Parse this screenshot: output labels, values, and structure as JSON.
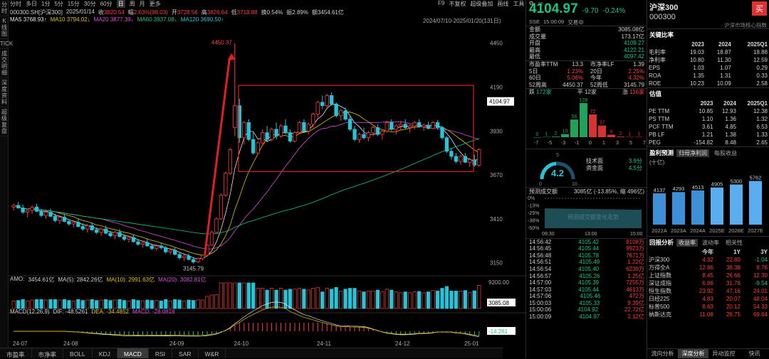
{
  "left_tabs": [
    "分时",
    "K线图",
    "TICK",
    "成交明细",
    "深度资料",
    "超级复盘"
  ],
  "top_toolbar": {
    "items": [
      "分时",
      "多日",
      "1分",
      "5分",
      "15分",
      "30分",
      "60分",
      "日",
      "周",
      "月",
      "更多"
    ],
    "active": "日",
    "right_items": [
      "F9",
      "不复权",
      "超级叠加",
      "画线",
      "工具",
      "⚙",
      "▭"
    ]
  },
  "info": {
    "code": "000300.SH[沪深300]",
    "date": "2025/01/14",
    "close_label": "收",
    "close": "3820.54",
    "change_label": "幅",
    "change": "2.63%(98.03)",
    "open_label": "开",
    "open": "3728.56",
    "high_label": "高",
    "high": "3826.64",
    "low_label": "低",
    "low": "3718.88",
    "turnover": "换0.54%",
    "amplitude": "振2.89%",
    "amount": "额3454.61亿"
  },
  "ma": [
    {
      "label": "MA5",
      "value": "3768.93↑",
      "color": "#e8e8e8"
    },
    {
      "label": "MA10",
      "value": "3794.02↓",
      "color": "#e6c200"
    },
    {
      "label": "MA20",
      "value": "3877.39↓",
      "color": "#d94fd9"
    },
    {
      "label": "MA60",
      "value": "3937.08↓",
      "color": "#16c784"
    },
    {
      "label": "MA120",
      "value": "3690.50↑",
      "color": "#27c4d8"
    }
  ],
  "range_label": "2024/07/10-2025/01/20(131日)",
  "chart_data": {
    "type": "candlestick",
    "x_ticks": [
      "24-07",
      "24-08",
      "24-09",
      "24-10",
      "24-11",
      "24-12",
      "25-01"
    ],
    "y_ticks": [
      4450,
      4190,
      3930,
      3670,
      3410,
      3150
    ],
    "ylim": [
      3090,
      4520
    ],
    "high_label": "4450.37",
    "low_label": "3145.79",
    "last_price_tag": "4104.97",
    "volume_ticks": [
      "9200.00",
      "3085.08"
    ],
    "macd_tag": "-14.261",
    "ohlc": [
      [
        3480,
        3500,
        3460,
        3490
      ],
      [
        3490,
        3510,
        3470,
        3475
      ],
      [
        3475,
        3495,
        3440,
        3450
      ],
      [
        3450,
        3470,
        3420,
        3460
      ],
      [
        3460,
        3490,
        3440,
        3480
      ],
      [
        3480,
        3500,
        3450,
        3455
      ],
      [
        3455,
        3470,
        3420,
        3430
      ],
      [
        3430,
        3460,
        3410,
        3450
      ],
      [
        3450,
        3470,
        3420,
        3425
      ],
      [
        3425,
        3440,
        3390,
        3400
      ],
      [
        3400,
        3430,
        3380,
        3420
      ],
      [
        3420,
        3440,
        3390,
        3395
      ],
      [
        3395,
        3410,
        3370,
        3380
      ],
      [
        3380,
        3400,
        3360,
        3390
      ],
      [
        3390,
        3410,
        3360,
        3365
      ],
      [
        3365,
        3385,
        3340,
        3350
      ],
      [
        3350,
        3380,
        3330,
        3370
      ],
      [
        3370,
        3390,
        3340,
        3345
      ],
      [
        3345,
        3360,
        3320,
        3330
      ],
      [
        3330,
        3360,
        3310,
        3350
      ],
      [
        3350,
        3370,
        3320,
        3325
      ],
      [
        3325,
        3340,
        3300,
        3310
      ],
      [
        3310,
        3340,
        3290,
        3330
      ],
      [
        3330,
        3350,
        3300,
        3305
      ],
      [
        3305,
        3320,
        3280,
        3290
      ],
      [
        3290,
        3310,
        3270,
        3300
      ],
      [
        3300,
        3320,
        3270,
        3275
      ],
      [
        3275,
        3290,
        3250,
        3260
      ],
      [
        3260,
        3280,
        3240,
        3270
      ],
      [
        3270,
        3290,
        3245,
        3250
      ],
      [
        3250,
        3265,
        3225,
        3235
      ],
      [
        3235,
        3260,
        3220,
        3250
      ],
      [
        3250,
        3270,
        3230,
        3240
      ],
      [
        3240,
        3250,
        3205,
        3215
      ],
      [
        3215,
        3235,
        3200,
        3225
      ],
      [
        3225,
        3240,
        3195,
        3200
      ],
      [
        3200,
        3215,
        3170,
        3180
      ],
      [
        3180,
        3200,
        3160,
        3190
      ],
      [
        3190,
        3205,
        3165,
        3170
      ],
      [
        3170,
        3185,
        3146,
        3155
      ],
      [
        3155,
        3180,
        3150,
        3175
      ],
      [
        3175,
        3200,
        3165,
        3195
      ],
      [
        3195,
        3260,
        3190,
        3255
      ],
      [
        3255,
        3340,
        3250,
        3330
      ],
      [
        3330,
        3420,
        3325,
        3410
      ],
      [
        3410,
        3560,
        3405,
        3550
      ],
      [
        3550,
        3690,
        3540,
        3680
      ],
      [
        3680,
        3830,
        3670,
        3820
      ],
      [
        3950,
        4450,
        3900,
        4080
      ],
      [
        4080,
        4120,
        3860,
        3890
      ],
      [
        3890,
        3990,
        3850,
        3980
      ],
      [
        3980,
        4000,
        3870,
        3880
      ],
      [
        3880,
        3920,
        3790,
        3800
      ],
      [
        3800,
        3870,
        3790,
        3860
      ],
      [
        3860,
        3940,
        3850,
        3920
      ],
      [
        3920,
        3960,
        3870,
        3880
      ],
      [
        3880,
        3950,
        3870,
        3940
      ],
      [
        3940,
        3980,
        3880,
        3900
      ],
      [
        3900,
        3970,
        3890,
        3960
      ],
      [
        3960,
        4000,
        3910,
        3920
      ],
      [
        3920,
        3940,
        3860,
        3870
      ],
      [
        3870,
        3930,
        3860,
        3920
      ],
      [
        3920,
        3990,
        3910,
        3980
      ],
      [
        3980,
        4000,
        3920,
        3930
      ],
      [
        3930,
        3980,
        3910,
        3970
      ],
      [
        3970,
        4040,
        3950,
        4030
      ],
      [
        4030,
        4110,
        4010,
        4100
      ],
      [
        4100,
        4140,
        4060,
        4080
      ],
      [
        4080,
        4150,
        4070,
        4140
      ],
      [
        4140,
        4160,
        4080,
        4090
      ],
      [
        4090,
        4100,
        4010,
        4020
      ],
      [
        4020,
        4060,
        3990,
        4050
      ],
      [
        4050,
        4070,
        3990,
        4000
      ],
      [
        4000,
        4020,
        3930,
        3940
      ],
      [
        3940,
        3960,
        3870,
        3880
      ],
      [
        3880,
        3920,
        3860,
        3910
      ],
      [
        3910,
        3950,
        3880,
        3890
      ],
      [
        3890,
        3930,
        3870,
        3920
      ],
      [
        3920,
        3960,
        3900,
        3950
      ],
      [
        3950,
        3970,
        3900,
        3910
      ],
      [
        3910,
        3940,
        3880,
        3930
      ],
      [
        3930,
        3990,
        3920,
        3980
      ],
      [
        3980,
        4000,
        3930,
        3940
      ],
      [
        3940,
        3970,
        3910,
        3960
      ],
      [
        3960,
        3990,
        3930,
        3970
      ],
      [
        3970,
        4000,
        3940,
        3950
      ],
      [
        3950,
        3970,
        3920,
        3960
      ],
      [
        3960,
        3990,
        3940,
        3980
      ],
      [
        3980,
        4000,
        3950,
        3955
      ],
      [
        3955,
        3975,
        3930,
        3965
      ],
      [
        3965,
        3985,
        3940,
        3945
      ],
      [
        3945,
        3990,
        3940,
        3980
      ],
      [
        3980,
        3995,
        3940,
        3950
      ],
      [
        3950,
        3960,
        3880,
        3890
      ],
      [
        3890,
        3900,
        3800,
        3810
      ],
      [
        3810,
        3830,
        3760,
        3780
      ],
      [
        3780,
        3800,
        3740,
        3750
      ],
      [
        3750,
        3790,
        3730,
        3780
      ],
      [
        3780,
        3800,
        3740,
        3745
      ],
      [
        3745,
        3770,
        3720,
        3760
      ],
      [
        3760,
        3790,
        3718,
        3728
      ],
      [
        3728,
        3826,
        3718,
        3820
      ]
    ]
  },
  "amo": {
    "label": "AMO:",
    "value": "3454.61亿",
    "ma5": "MA(5): 2842.26亿",
    "ma10": "MA(10): 2991.63亿",
    "ma20": "MA(20): 3082.81亿"
  },
  "macd": {
    "label": "MACD(12,26,9)",
    "dif": "DIF: -48.5261",
    "dea": "DEA: -34.4852",
    "macd": "MACD: -28.0818"
  },
  "bottom_tabs": [
    "市盈率",
    "市净率",
    "BOLL",
    "KDJ",
    "MACD",
    "RSI",
    "SAR",
    "W&R"
  ],
  "bottom_active": "MACD",
  "quote": {
    "price": "4104.97",
    "change": "-9.70",
    "pct": "-0.24%",
    "exchange": "SSE",
    "time": "15:00:09",
    "status": "交易中"
  },
  "stats": [
    [
      "金额",
      "3085.08亿"
    ],
    [
      "成交量",
      "173.17亿"
    ],
    [
      "开盘",
      "4109.27"
    ],
    [
      "最高",
      "4122.21"
    ],
    [
      "最低",
      "4097.42"
    ]
  ],
  "ratios": [
    [
      "市盈率TTM",
      "13.3",
      "市净率LF",
      "1.39"
    ],
    [
      "5日",
      "1.23%",
      "20日",
      "2.25%"
    ],
    [
      "60日",
      "5.06%",
      "今年",
      "4.32%"
    ],
    [
      "52周高",
      "4450.37",
      "52周低",
      "3145.79"
    ]
  ],
  "breadth": {
    "down_label": "跌",
    "down": "172家",
    "flat_label": "平",
    "flat": "12家",
    "up_label": "涨",
    "up": "116家"
  },
  "dist": {
    "labels": [
      "-7",
      "-5",
      "-3",
      "-1",
      "0",
      "1",
      "3",
      "5",
      "7"
    ],
    "values": [
      0,
      1,
      2,
      10,
      56,
      108,
      72,
      37,
      8,
      2,
      1,
      1
    ],
    "bars_labels": [
      "0",
      "1",
      "2",
      "10",
      "56",
      "108",
      "72",
      "37",
      "8",
      "2",
      "1",
      "1"
    ]
  },
  "gauge": {
    "score": "4.2",
    "min": "0",
    "max": "10",
    "mid": "5",
    "tech_label": "技术面",
    "tech": "3.9分",
    "fund_label": "资金面",
    "fund": "4.5分"
  },
  "forecast": {
    "label": "预测成交额",
    "value": "3085亿 (-13.85%, 缩 496亿)",
    "y_ticks": [
      "0%",
      "-13%",
      "-25%",
      "-38%",
      "-50%"
    ],
    "x_ticks": [
      "09:30",
      "13:00",
      "15:00"
    ],
    "watermark": "预测成交额变化走势"
  },
  "ticks": [
    [
      "14:56:42",
      "4105.42",
      "8108万"
    ],
    [
      "14:56:45",
      "4105.44",
      "9923万"
    ],
    [
      "14:56:48",
      "4105.78",
      "7671万"
    ],
    [
      "14:56:51",
      "4105.49",
      "1.22亿"
    ],
    [
      "14:56:54",
      "4105.40",
      "6239万"
    ],
    [
      "14:56:57",
      "4105.26",
      "1.25亿"
    ],
    [
      "14:57:00",
      "4105.39",
      "7255万"
    ],
    [
      "14:57:03",
      "4105.44",
      "4613万"
    ],
    [
      "14:57:06",
      "4105.46",
      "472万"
    ],
    [
      "15:00:03",
      "4105.33",
      "9.39亿"
    ],
    [
      "15:00:06",
      "4104.92",
      "22.72亿"
    ],
    [
      "15:00:09",
      "4104.97",
      "2.12亿"
    ]
  ],
  "right": {
    "title": "沪深300",
    "code": "000300",
    "buy_btn": "买",
    "subtitle": "沪深市场核心指数",
    "key_ratio_title": "关键比率",
    "key_cols": [
      "",
      "2023",
      "2024",
      "2025Q1"
    ],
    "key_rows": [
      [
        "毛利率",
        "19.03",
        "18.87",
        "18.88"
      ],
      [
        "净利率",
        "10.80",
        "11.30",
        "12.59"
      ],
      [
        "EPS",
        "1.03",
        "1.07",
        "0.29"
      ],
      [
        "ROA",
        "1.35",
        "1.31",
        "0.33"
      ],
      [
        "ROE",
        "10.23",
        "10.09",
        "2.58"
      ]
    ],
    "val_title": "估值",
    "val_cols": [
      "",
      "2023",
      "2024",
      "2025Q1"
    ],
    "val_rows": [
      [
        "PE TTM",
        "10.85",
        "12.93",
        "12.38"
      ],
      [
        "PS TTM",
        "1.10",
        "1.36",
        "1.32"
      ],
      [
        "PCF TTM",
        "3.61",
        "4.85",
        "6.53"
      ],
      [
        "PB LF",
        "1.21",
        "1.38",
        "1.33"
      ],
      [
        "PEG",
        "-154.82",
        "8.48",
        "2.65"
      ]
    ],
    "profit_title": "盈利预测",
    "profit_unit": "(十亿)",
    "profit_tab1": "归母净利润",
    "profit_tab2": "每股收益",
    "profit": {
      "labels": [
        "2022A",
        "2023A",
        "2024A",
        "2025E",
        "2026E",
        "2027E"
      ],
      "values": [
        4137,
        4293,
        4513,
        4905,
        5300,
        5762
      ]
    },
    "ret_title": "回报分析",
    "ret_tabs": [
      "收益率",
      "波动率",
      "相关性"
    ],
    "ret_cols": [
      "",
      "今年",
      "1Y",
      "3Y"
    ],
    "ret_rows": [
      [
        "沪深300",
        "4.32",
        "22.80",
        "-1.04"
      ],
      [
        "万得全A",
        "12.86",
        "38.38",
        "8.76"
      ],
      [
        "上证指数",
        "8.45",
        "26.66",
        "12.30"
      ],
      [
        "深证成指",
        "6.86",
        "31.76",
        "-9.54"
      ],
      [
        "恒生指数",
        "23.92",
        "47.16",
        "24.01"
      ],
      [
        "日经225",
        "4.83",
        "20.07",
        "48.04"
      ],
      [
        "标普500",
        "8.63",
        "20.12",
        "54.33"
      ],
      [
        "纳斯达克",
        "11.08",
        "28.75",
        "69.64"
      ]
    ],
    "foot_tabs": [
      "流向分析",
      "深度分析",
      "异动监控",
      "快讯"
    ],
    "foot_active": "深度分析"
  },
  "colors": {
    "up": "#ff3b3b",
    "down": "#16c784",
    "accent": "#e6c200"
  }
}
